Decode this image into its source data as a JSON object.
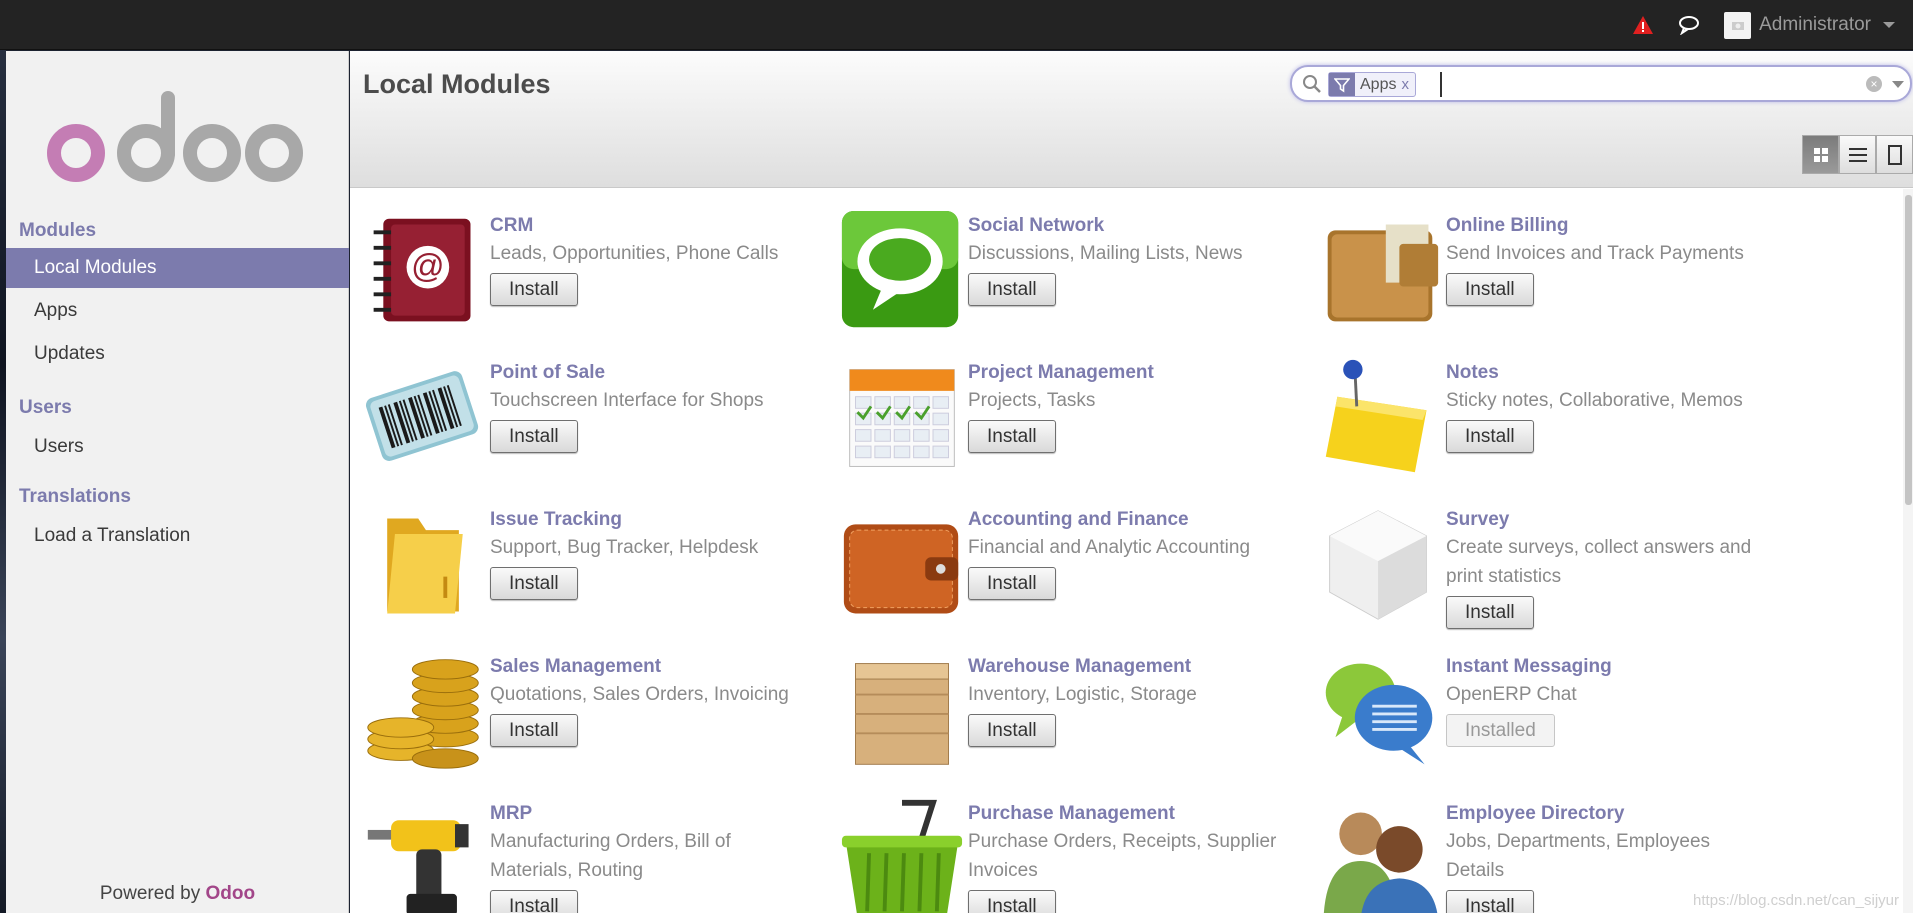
{
  "topbar": {
    "user_name": "Administrator",
    "icons": [
      "alert-icon",
      "chat-icon",
      "avatar-icon",
      "caret-down-icon"
    ]
  },
  "sidebar": {
    "logo_text": "odoo",
    "sections": [
      {
        "header": "Modules",
        "items": [
          {
            "label": "Local Modules",
            "active": true
          },
          {
            "label": "Apps",
            "active": false
          },
          {
            "label": "Updates",
            "active": false
          }
        ]
      },
      {
        "header": "Users",
        "items": [
          {
            "label": "Users",
            "active": false
          }
        ]
      },
      {
        "header": "Translations",
        "items": [
          {
            "label": "Load a Translation",
            "active": false
          }
        ]
      }
    ],
    "powered_prefix": "Powered by",
    "powered_brand": "Odoo"
  },
  "header": {
    "title": "Local Modules",
    "search": {
      "facet_label": "Apps",
      "facet_remove": "x",
      "value": ""
    },
    "views": [
      "kanban",
      "list",
      "form"
    ]
  },
  "colors": {
    "accent": "#7c7bad",
    "brand": "#a24689",
    "topbar": "#232323"
  },
  "modules": [
    {
      "name": "CRM",
      "summary": "Leads, Opportunities, Phone Calls",
      "button": "Install",
      "installed": false,
      "icon": "address-book-icon"
    },
    {
      "name": "Social Network",
      "summary": "Discussions, Mailing Lists, News",
      "button": "Install",
      "installed": false,
      "icon": "speech-bubble-icon"
    },
    {
      "name": "Online Billing",
      "summary": "Send Invoices and Track Payments",
      "button": "Install",
      "installed": false,
      "icon": "wallet-icon"
    },
    {
      "name": "Point of Sale",
      "summary": "Touchscreen Interface for Shops",
      "button": "Install",
      "installed": false,
      "icon": "barcode-icon"
    },
    {
      "name": "Project Management",
      "summary": "Projects, Tasks",
      "button": "Install",
      "installed": false,
      "icon": "calendar-icon"
    },
    {
      "name": "Notes",
      "summary": "Sticky notes, Collaborative, Memos",
      "button": "Install",
      "installed": false,
      "icon": "sticky-note-icon"
    },
    {
      "name": "Issue Tracking",
      "summary": "Support, Bug Tracker, Helpdesk",
      "button": "Install",
      "installed": false,
      "icon": "folder-icon"
    },
    {
      "name": "Accounting and Finance",
      "summary": "Financial and Analytic Accounting",
      "button": "Install",
      "installed": false,
      "icon": "leather-wallet-icon"
    },
    {
      "name": "Survey",
      "summary": "Create surveys, collect answers and print statistics",
      "button": "Install",
      "installed": false,
      "icon": "cube-icon"
    },
    {
      "name": "Sales Management",
      "summary": "Quotations, Sales Orders, Invoicing",
      "button": "Install",
      "installed": false,
      "icon": "coins-icon"
    },
    {
      "name": "Warehouse Management",
      "summary": "Inventory, Logistic, Storage",
      "button": "Install",
      "installed": false,
      "icon": "crate-icon"
    },
    {
      "name": "Instant Messaging",
      "summary": "OpenERP Chat",
      "button": "Installed",
      "installed": true,
      "icon": "chat-bubbles-icon"
    },
    {
      "name": "MRP",
      "summary": "Manufacturing Orders, Bill of Materials, Routing",
      "button": "Install",
      "installed": false,
      "icon": "drill-icon"
    },
    {
      "name": "Purchase Management",
      "summary": "Purchase Orders, Receipts, Supplier Invoices",
      "button": "Install",
      "installed": false,
      "icon": "basket-icon"
    },
    {
      "name": "Employee Directory",
      "summary": "Jobs, Departments, Employees Details",
      "button": "Install",
      "installed": false,
      "icon": "people-icon"
    }
  ],
  "watermark": "https://blog.csdn.net/can_sijyur"
}
